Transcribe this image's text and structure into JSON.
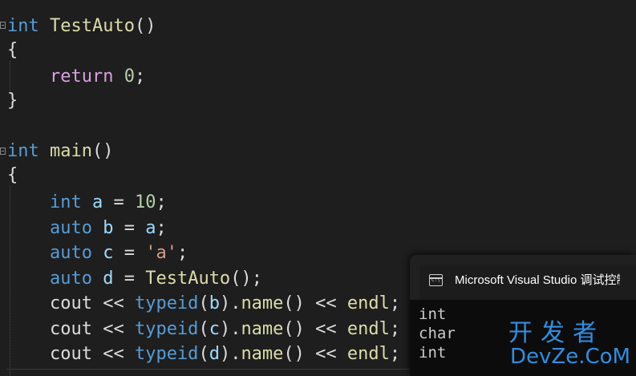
{
  "editor": {
    "function_testauto": {
      "ret_type": "int",
      "name": "TestAuto",
      "parens": "()",
      "open_brace": "{",
      "return_kw": "return",
      "return_val": "0",
      "semicolon": ";",
      "close_brace": "}"
    },
    "function_main": {
      "ret_type": "int",
      "name": "main",
      "parens": "()",
      "open_brace": "{",
      "line_a": {
        "type": "int",
        "var": "a",
        "op": " = ",
        "value": "10",
        "end": ";"
      },
      "line_b": {
        "type": "auto",
        "var": "b",
        "op": " = ",
        "value": "a",
        "end": ";"
      },
      "line_c": {
        "type": "auto",
        "var": "c",
        "op": " = ",
        "value": "'a'",
        "end": ";"
      },
      "line_d": {
        "type": "auto",
        "var": "d",
        "op": " = ",
        "value": "TestAuto",
        "call": "()",
        "end": ";"
      },
      "cout_lines": [
        {
          "cout": "cout",
          "op": " << ",
          "typeid": "typeid",
          "open": "(",
          "arg": "b",
          "close": ")",
          "dot": ".",
          "name_fn": "name",
          "call": "()",
          "op2": " << ",
          "endl": "endl",
          "end": ";"
        },
        {
          "cout": "cout",
          "op": " << ",
          "typeid": "typeid",
          "open": "(",
          "arg": "c",
          "close": ")",
          "dot": ".",
          "name_fn": "name",
          "call": "()",
          "op2": " << ",
          "endl": "endl",
          "end": ";"
        },
        {
          "cout": "cout",
          "op": " << ",
          "typeid": "typeid",
          "open": "(",
          "arg": "d",
          "close": ")",
          "dot": ".",
          "name_fn": "name",
          "call": "()",
          "op2": " << ",
          "endl": "endl",
          "end": ";"
        }
      ]
    },
    "colors": {
      "background": "#1e1e1e",
      "keyword": "#569cd6",
      "control": "#d8a0df",
      "function": "#dcdcaa",
      "number": "#b5cea8",
      "variable": "#9cdcfe",
      "string": "#d69d85"
    }
  },
  "console": {
    "icon": "console-icon",
    "title": "Microsoft Visual Studio 调试控制台",
    "close_glyph": "×",
    "output": [
      "int",
      "char",
      "int"
    ]
  },
  "watermark": {
    "top": "开发者",
    "bottom": "DevZe.CoM"
  }
}
